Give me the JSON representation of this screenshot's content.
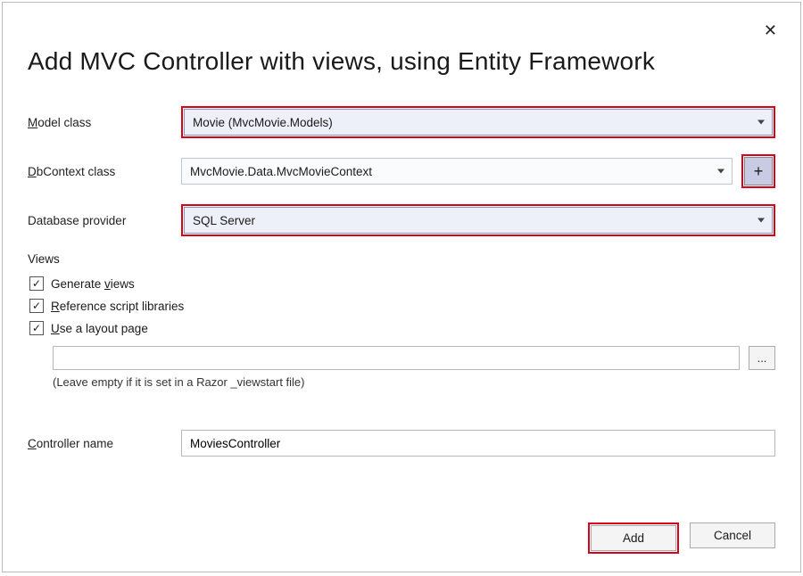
{
  "dialog": {
    "title": "Add MVC Controller with views, using Entity Framework"
  },
  "labels": {
    "model_class_pre": "M",
    "model_class_post": "odel class",
    "dbcontext_pre": "D",
    "dbcontext_post": "bContext class",
    "database_provider": "Database provider",
    "views_header": "Views",
    "controller_pre": "C",
    "controller_post": "ontroller name"
  },
  "fields": {
    "model_class": "Movie (MvcMovie.Models)",
    "dbcontext_class": "MvcMovie.Data.MvcMovieContext",
    "database_provider": "SQL Server",
    "controller_name": "MoviesController",
    "layout_page": ""
  },
  "checkboxes": {
    "generate_views_pre": "Generate ",
    "generate_views_u": "v",
    "generate_views_post": "iews",
    "reference_u": "R",
    "reference_post": "eference script libraries",
    "layout_u": "U",
    "layout_post": "se a layout page"
  },
  "hint": "(Leave empty if it is set in a Razor _viewstart file)",
  "buttons": {
    "plus": "+",
    "browse": "...",
    "add": "Add",
    "cancel": "Cancel"
  },
  "icons": {
    "close": "✕",
    "check": "✓"
  }
}
